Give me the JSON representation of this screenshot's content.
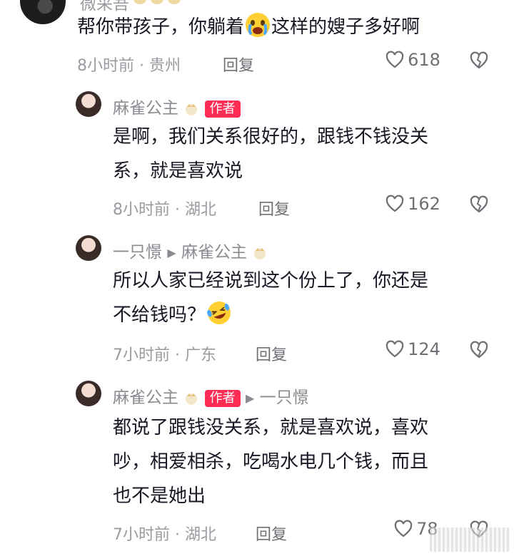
{
  "top_comment": {
    "username_partial": "微采吾",
    "text_before": "帮你带孩子，你躺着",
    "text_after": "这样的嫂子多好啊",
    "time": "8小时前",
    "location": "贵州",
    "reply_label": "回复",
    "likes": "618"
  },
  "reply1": {
    "name": "麻雀公主",
    "badge": "作者",
    "line1": "是啊，我们关系很好的，跟钱不钱没关",
    "line2": "系，就是喜欢说",
    "time": "8小时前",
    "location": "湖北",
    "reply_label": "回复",
    "likes": "162"
  },
  "reply2": {
    "name": "一只憬",
    "reply_to": "麻雀公主",
    "line1": "所以人家已经说到这个份上了，你还是",
    "line2": "不给钱吗？",
    "time": "7小时前",
    "location": "广东",
    "reply_label": "回复",
    "likes": "124"
  },
  "reply3": {
    "name": "麻雀公主",
    "badge": "作者",
    "reply_to": "一只憬",
    "line1": "都说了跟钱没关系，就是喜欢说，喜欢",
    "line2": "吵，相爱相杀，吃喝水电几个钱，而且",
    "line3": "也不是她出",
    "time": "7小时前",
    "location": "湖北",
    "reply_label": "回复",
    "likes": "78"
  },
  "separator": "·",
  "colors": {
    "badge_bg": "#fe2c55",
    "meta_gray": "#9a9ba1",
    "text_dark": "#161823"
  },
  "icons": [
    "heart-outline-icon",
    "broken-heart-icon",
    "crying-face-emoji",
    "laughing-face-emoji",
    "crown-icon",
    "triangle-right-icon"
  ]
}
